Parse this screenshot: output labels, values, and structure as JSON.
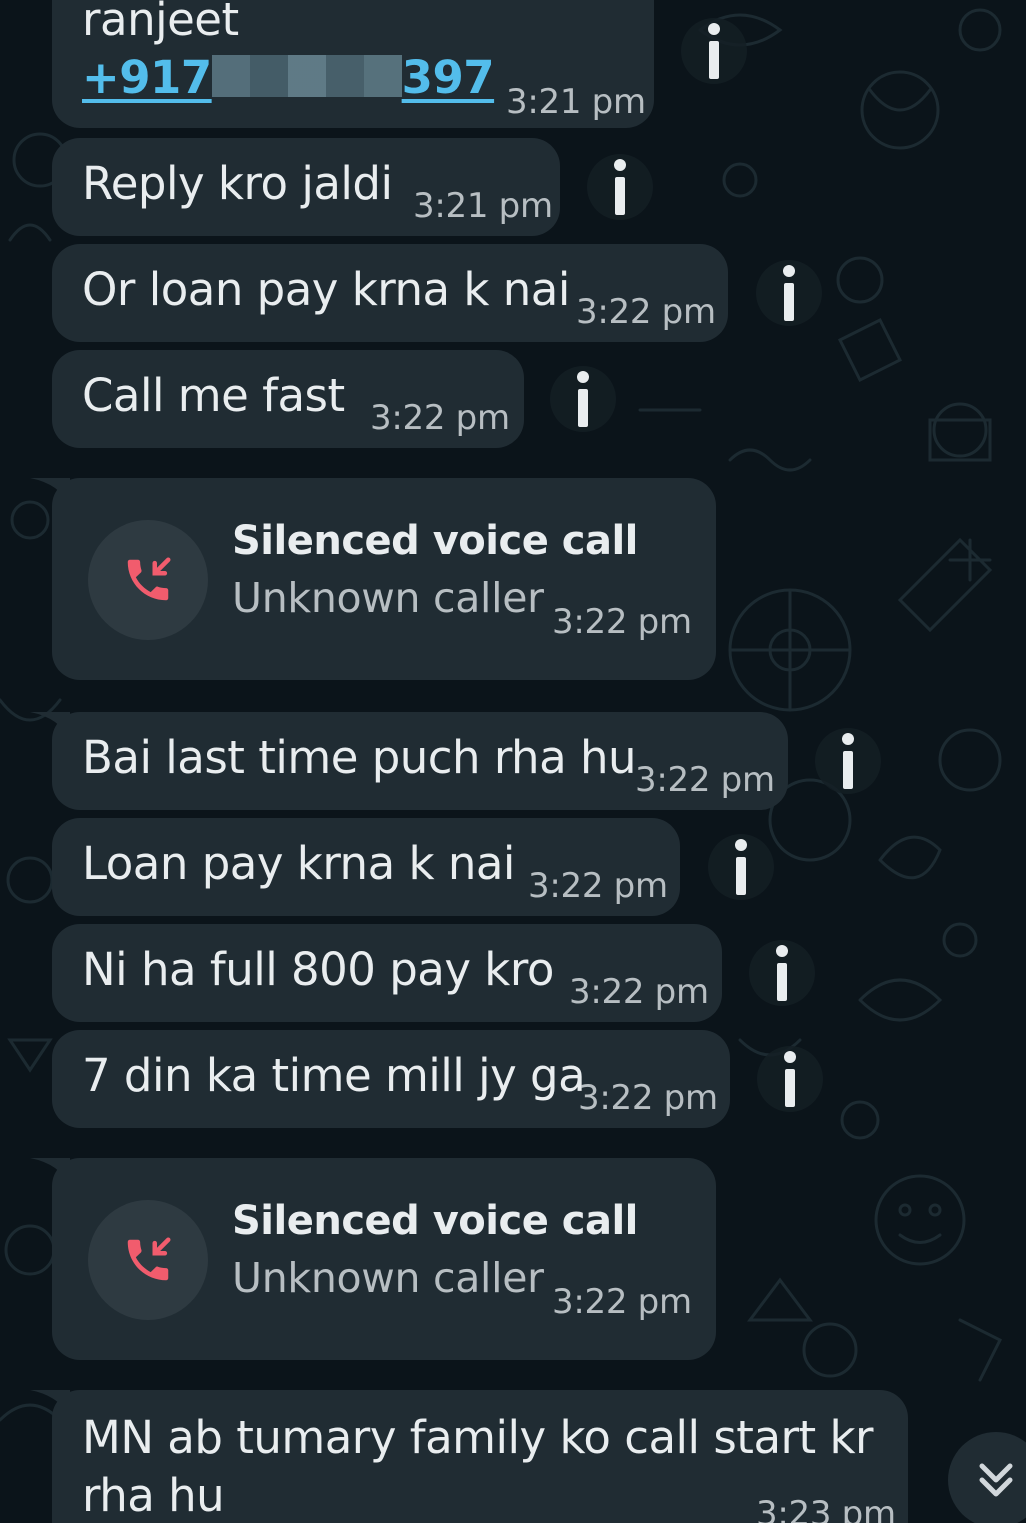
{
  "colors": {
    "background": "#0b141a",
    "bubble": "#202c33",
    "text": "#e9edef",
    "timestamp": "#b7bec2",
    "link": "#53bdeb",
    "missed_call": "#f15c6d"
  },
  "contact_card": {
    "name": "ranjeet",
    "phone_prefix": "+917",
    "phone_suffix": "397",
    "time": "3:21 pm"
  },
  "messages": [
    {
      "text": "Reply kro jaldi",
      "time": "3:21 pm"
    },
    {
      "text": "Or loan pay krna k nai",
      "time": "3:22 pm"
    },
    {
      "text": "Call me fast",
      "time": "3:22 pm"
    },
    {
      "text": "Bai last time puch rha hu",
      "time": "3:22 pm"
    },
    {
      "text": "Loan pay krna k nai",
      "time": "3:22 pm"
    },
    {
      "text": "Ni ha full 800 pay kro",
      "time": "3:22 pm"
    },
    {
      "text": "7 din ka time mill jy ga",
      "time": "3:22 pm"
    }
  ],
  "calls": [
    {
      "title": "Silenced voice call",
      "subtitle": "Unknown caller",
      "time": "3:22 pm",
      "icon": "missed-call-icon"
    },
    {
      "title": "Silenced voice call",
      "subtitle": "Unknown caller",
      "time": "3:22 pm",
      "icon": "missed-call-icon"
    }
  ],
  "last_message": {
    "line1": "MN ab tumary family ko call start kr",
    "line2": "rha hu",
    "time": "3:23 pm"
  },
  "icons": {
    "info": "info-icon",
    "scroll_down": "double-chevron-down-icon",
    "missed_call": "missed-call-icon"
  }
}
